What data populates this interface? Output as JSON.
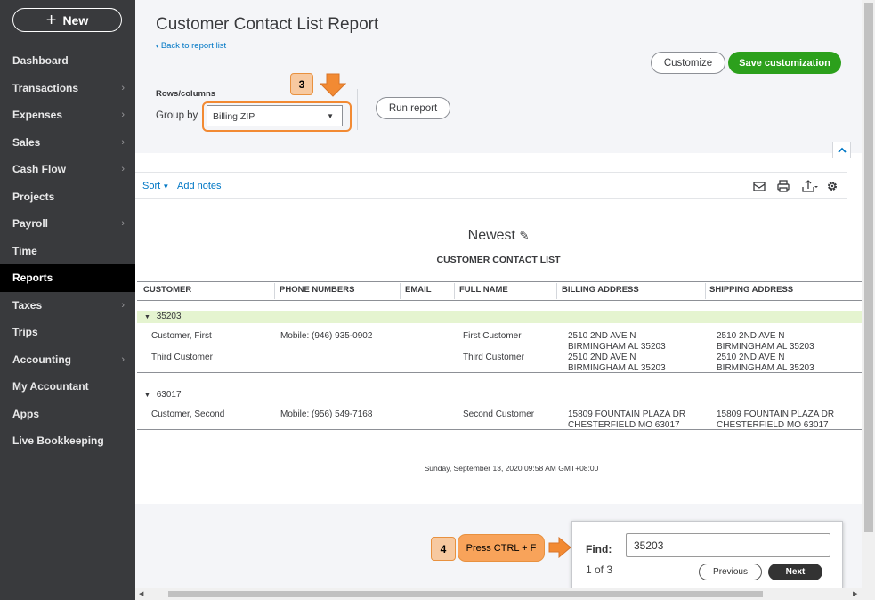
{
  "sidebar": {
    "new_label": "New",
    "items": [
      {
        "label": "Dashboard",
        "chevron": false,
        "active": false
      },
      {
        "label": "Transactions",
        "chevron": true,
        "active": false
      },
      {
        "label": "Expenses",
        "chevron": true,
        "active": false
      },
      {
        "label": "Sales",
        "chevron": true,
        "active": false
      },
      {
        "label": "Cash Flow",
        "chevron": true,
        "active": false
      },
      {
        "label": "Projects",
        "chevron": false,
        "active": false
      },
      {
        "label": "Payroll",
        "chevron": true,
        "active": false
      },
      {
        "label": "Time",
        "chevron": false,
        "active": false
      },
      {
        "label": "Reports",
        "chevron": false,
        "active": true
      },
      {
        "label": "Taxes",
        "chevron": true,
        "active": false
      },
      {
        "label": "Trips",
        "chevron": false,
        "active": false
      },
      {
        "label": "Accounting",
        "chevron": true,
        "active": false
      },
      {
        "label": "My Accountant",
        "chevron": false,
        "active": false
      },
      {
        "label": "Apps",
        "chevron": false,
        "active": false
      },
      {
        "label": "Live Bookkeeping",
        "chevron": false,
        "active": false
      }
    ]
  },
  "header": {
    "title": "Customer Contact List Report",
    "back_link": "Back to report list",
    "customize_label": "Customize",
    "save_label": "Save customization",
    "rows_columns_label": "Rows/columns",
    "group_by_label": "Group by",
    "group_by_value": "Billing ZIP",
    "run_report_label": "Run report"
  },
  "callouts": {
    "step3": "3",
    "step4": "4",
    "step4_text": "Press CTRL + F"
  },
  "toolbar": {
    "sort_label": "Sort",
    "add_notes_label": "Add notes"
  },
  "report": {
    "company": "Newest",
    "title": "CUSTOMER CONTACT LIST",
    "columns": [
      "CUSTOMER",
      "PHONE NUMBERS",
      "EMAIL",
      "FULL NAME",
      "BILLING ADDRESS",
      "SHIPPING ADDRESS"
    ],
    "groups": [
      {
        "zip": "35203",
        "rows": [
          {
            "customer": "Customer, First",
            "phone": "Mobile: (946) 935-0902",
            "email": "",
            "full_name": "First Customer",
            "billing_1": "2510 2ND AVE N",
            "billing_2": "BIRMINGHAM AL 35203",
            "shipping_1": "2510 2ND AVE N",
            "shipping_2": "BIRMINGHAM AL 35203"
          },
          {
            "customer": "Third Customer",
            "phone": "",
            "email": "",
            "full_name": "Third Customer",
            "billing_1": "2510 2ND AVE N",
            "billing_2": "BIRMINGHAM AL 35203",
            "shipping_1": "2510 2ND AVE N",
            "shipping_2": "BIRMINGHAM AL 35203"
          }
        ]
      },
      {
        "zip": "63017",
        "rows": [
          {
            "customer": "Customer, Second",
            "phone": "Mobile: (956) 549-7168",
            "email": "",
            "full_name": "Second Customer",
            "billing_1": "15809 FOUNTAIN PLAZA DR",
            "billing_2": "CHESTERFIELD MO 63017",
            "shipping_1": "15809 FOUNTAIN PLAZA DR",
            "shipping_2": "CHESTERFIELD MO 63017"
          }
        ]
      }
    ],
    "footer": "Sunday, September 13, 2020   09:58 AM GMT+08:00"
  },
  "find": {
    "label": "Find:",
    "value": "35203",
    "count": "1 of 3",
    "previous_label": "Previous",
    "next_label": "Next"
  },
  "colors": {
    "sidebar_bg": "#393a3d",
    "accent_green": "#2ca01c",
    "link_blue": "#0077c5",
    "highlight_row": "#e5f4d0",
    "callout_orange": "#f28a33"
  }
}
